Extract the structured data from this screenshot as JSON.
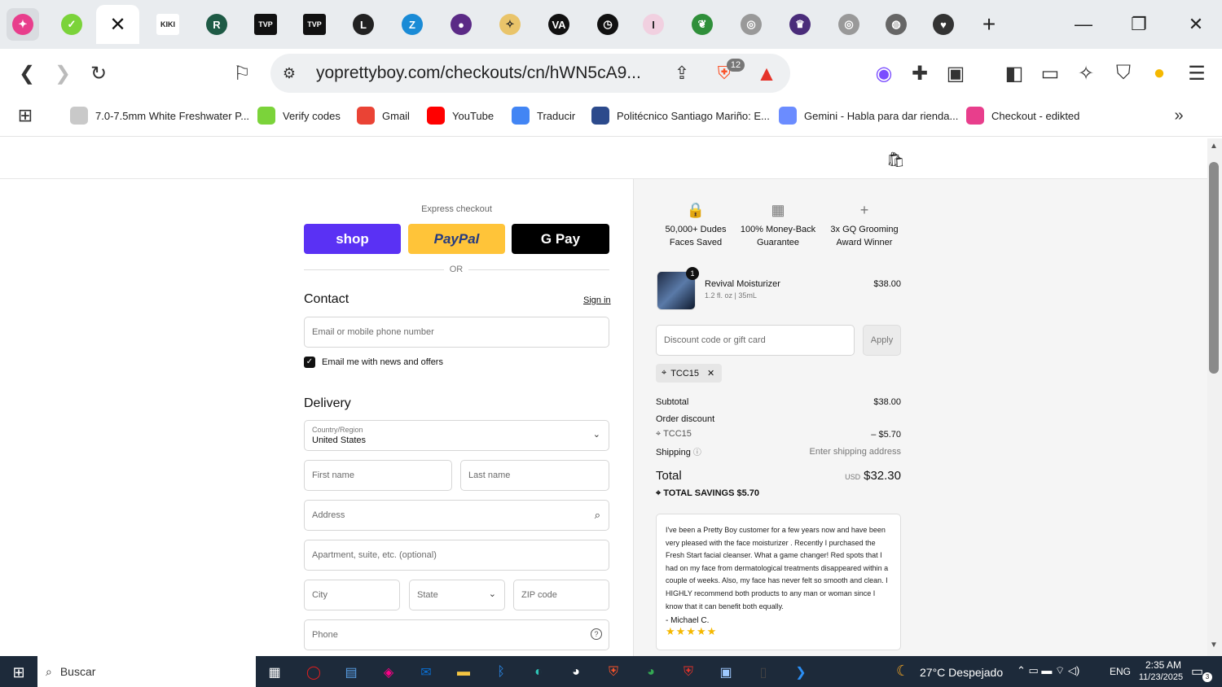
{
  "browser": {
    "tabs": [
      {
        "name": "tab-gemini",
        "icon": "sparkle-icon",
        "color": "#e83e8c",
        "glyph": "✦"
      },
      {
        "name": "tab-verify",
        "icon": "leaf-icon",
        "color": "#7bd33a",
        "glyph": "✓"
      },
      {
        "name": "tab-kiki",
        "icon": "kiki-icon",
        "color": "#ffffff",
        "glyph": "KIKI"
      },
      {
        "name": "tab-r",
        "icon": "r-icon",
        "color": "#1e5a45",
        "glyph": "R"
      },
      {
        "name": "tab-tvp1",
        "icon": "tvp-icon",
        "color": "#111111",
        "glyph": "TVP"
      },
      {
        "name": "tab-tvp2",
        "icon": "tvp-icon",
        "color": "#111111",
        "glyph": "TVP"
      },
      {
        "name": "tab-l",
        "icon": "l-icon",
        "color": "#222222",
        "glyph": "L"
      },
      {
        "name": "tab-z",
        "icon": "z-icon",
        "color": "#1a8bd6",
        "glyph": "Z"
      },
      {
        "name": "tab-purple",
        "icon": "purple-circle-icon",
        "color": "#5b2a86",
        "glyph": "●"
      },
      {
        "name": "tab-gold",
        "icon": "gold-icon",
        "color": "#e9c46a",
        "glyph": "✧"
      },
      {
        "name": "tab-va",
        "icon": "va-icon",
        "color": "#111111",
        "glyph": "VA"
      },
      {
        "name": "tab-clock",
        "icon": "clock-icon",
        "color": "#111111",
        "glyph": "◷"
      },
      {
        "name": "tab-i",
        "icon": "i-icon",
        "color": "#f1d0e0",
        "glyph": "I"
      },
      {
        "name": "tab-green",
        "icon": "green-leaf-icon",
        "color": "#2f8f3a",
        "glyph": "❦"
      },
      {
        "name": "tab-gray1",
        "icon": "gray-circle-icon",
        "color": "#999999",
        "glyph": "◎"
      },
      {
        "name": "tab-crest",
        "icon": "crest-icon",
        "color": "#4a2c7a",
        "glyph": "♛"
      },
      {
        "name": "tab-gray2",
        "icon": "gray-circle-icon",
        "color": "#999999",
        "glyph": "◎"
      },
      {
        "name": "tab-globe",
        "icon": "globe-icon",
        "color": "#666666",
        "glyph": "◍"
      },
      {
        "name": "tab-heart",
        "icon": "heart-icon",
        "color": "#333333",
        "glyph": "♥"
      }
    ],
    "active_tab_close": "✕",
    "new_tab": "+",
    "url": "yoprettyboy.com/checkouts/cn/hWN5cA9...",
    "brave_badge": "12"
  },
  "bookmarks": [
    {
      "label": "7.0-7.5mm White Freshwater P...",
      "icon": "pearl-icon",
      "color": "#c9c9c9"
    },
    {
      "label": "Verify codes",
      "icon": "leaf-icon",
      "color": "#7bd33a"
    },
    {
      "label": "Gmail",
      "icon": "gmail-icon",
      "color": "#ea4335"
    },
    {
      "label": "YouTube",
      "icon": "youtube-icon",
      "color": "#ff0000"
    },
    {
      "label": "Traducir",
      "icon": "translate-icon",
      "color": "#4285f4"
    },
    {
      "label": "Politécnico Santiago Mariño: E...",
      "icon": "building-icon",
      "color": "#2c4a8c"
    },
    {
      "label": "Gemini - Habla para dar rienda...",
      "icon": "gemini-icon",
      "color": "#6b8cff"
    },
    {
      "label": "Checkout - edikted",
      "icon": "sparkle-icon",
      "color": "#e83e8c"
    }
  ],
  "checkout": {
    "express_label": "Express checkout",
    "shop_label": "shop",
    "paypal_label": "PayPal",
    "gpay_label": "G Pay",
    "or_label": "OR",
    "contact_title": "Contact",
    "sign_in": "Sign in",
    "email_placeholder": "Email or mobile phone number",
    "newsletter_label": "Email me with news and offers",
    "delivery_title": "Delivery",
    "country_label": "Country/Region",
    "country_value": "United States",
    "first_name": "First name",
    "last_name": "Last name",
    "address": "Address",
    "apartment": "Apartment, suite, etc. (optional)",
    "city": "City",
    "state": "State",
    "zip": "ZIP code",
    "phone": "Phone"
  },
  "summary": {
    "badges": [
      {
        "icon": "lock-icon",
        "line1": "50,000+ Dudes",
        "line2": "Faces Saved"
      },
      {
        "icon": "store-icon",
        "line1": "100% Money-Back",
        "line2": "Guarantee"
      },
      {
        "icon": "plus-icon",
        "line1": "3x GQ Grooming",
        "line2": "Award Winner"
      }
    ],
    "product_name": "Revival Moisturizer",
    "product_variant": "1.2 fl. oz | 35mL",
    "product_price": "$38.00",
    "product_qty": "1",
    "discount_placeholder": "Discount code or gift card",
    "apply_label": "Apply",
    "code_tag": "TCC15",
    "subtotal_label": "Subtotal",
    "subtotal_value": "$38.00",
    "order_discount_label": "Order discount",
    "discount_code": "TCC15",
    "discount_value": "– $5.70",
    "shipping_label": "Shipping",
    "shipping_value": "Enter shipping address",
    "total_label": "Total",
    "total_currency": "USD",
    "total_value": "$32.30",
    "savings_label": "TOTAL SAVINGS",
    "savings_value": "$5.70",
    "review_text": "I've been a Pretty Boy customer for a few years now and have been very pleased with the face moisturizer . Recently I purchased the Fresh Start facial cleanser. What a game changer! Red spots that I had on my face from dermatological treatments disappeared within a couple of weeks. Also, my face has never felt so smooth and clean. I HIGHLY recommend both products to any man or woman since I know that it can benefit both equally.",
    "review_author": "- Michael C.",
    "review_stars": "★★★★★",
    "star_color": "#f5b800"
  },
  "taskbar": {
    "search_placeholder": "Buscar",
    "weather": "27°C  Despejado",
    "lang": "ENG",
    "time": "2:35 AM",
    "date": "11/23/2025",
    "notifications": "3"
  },
  "colors": {
    "shop_purple": "#5a31f4",
    "paypal_yellow": "#ffc439",
    "gpay_black": "#000000"
  }
}
